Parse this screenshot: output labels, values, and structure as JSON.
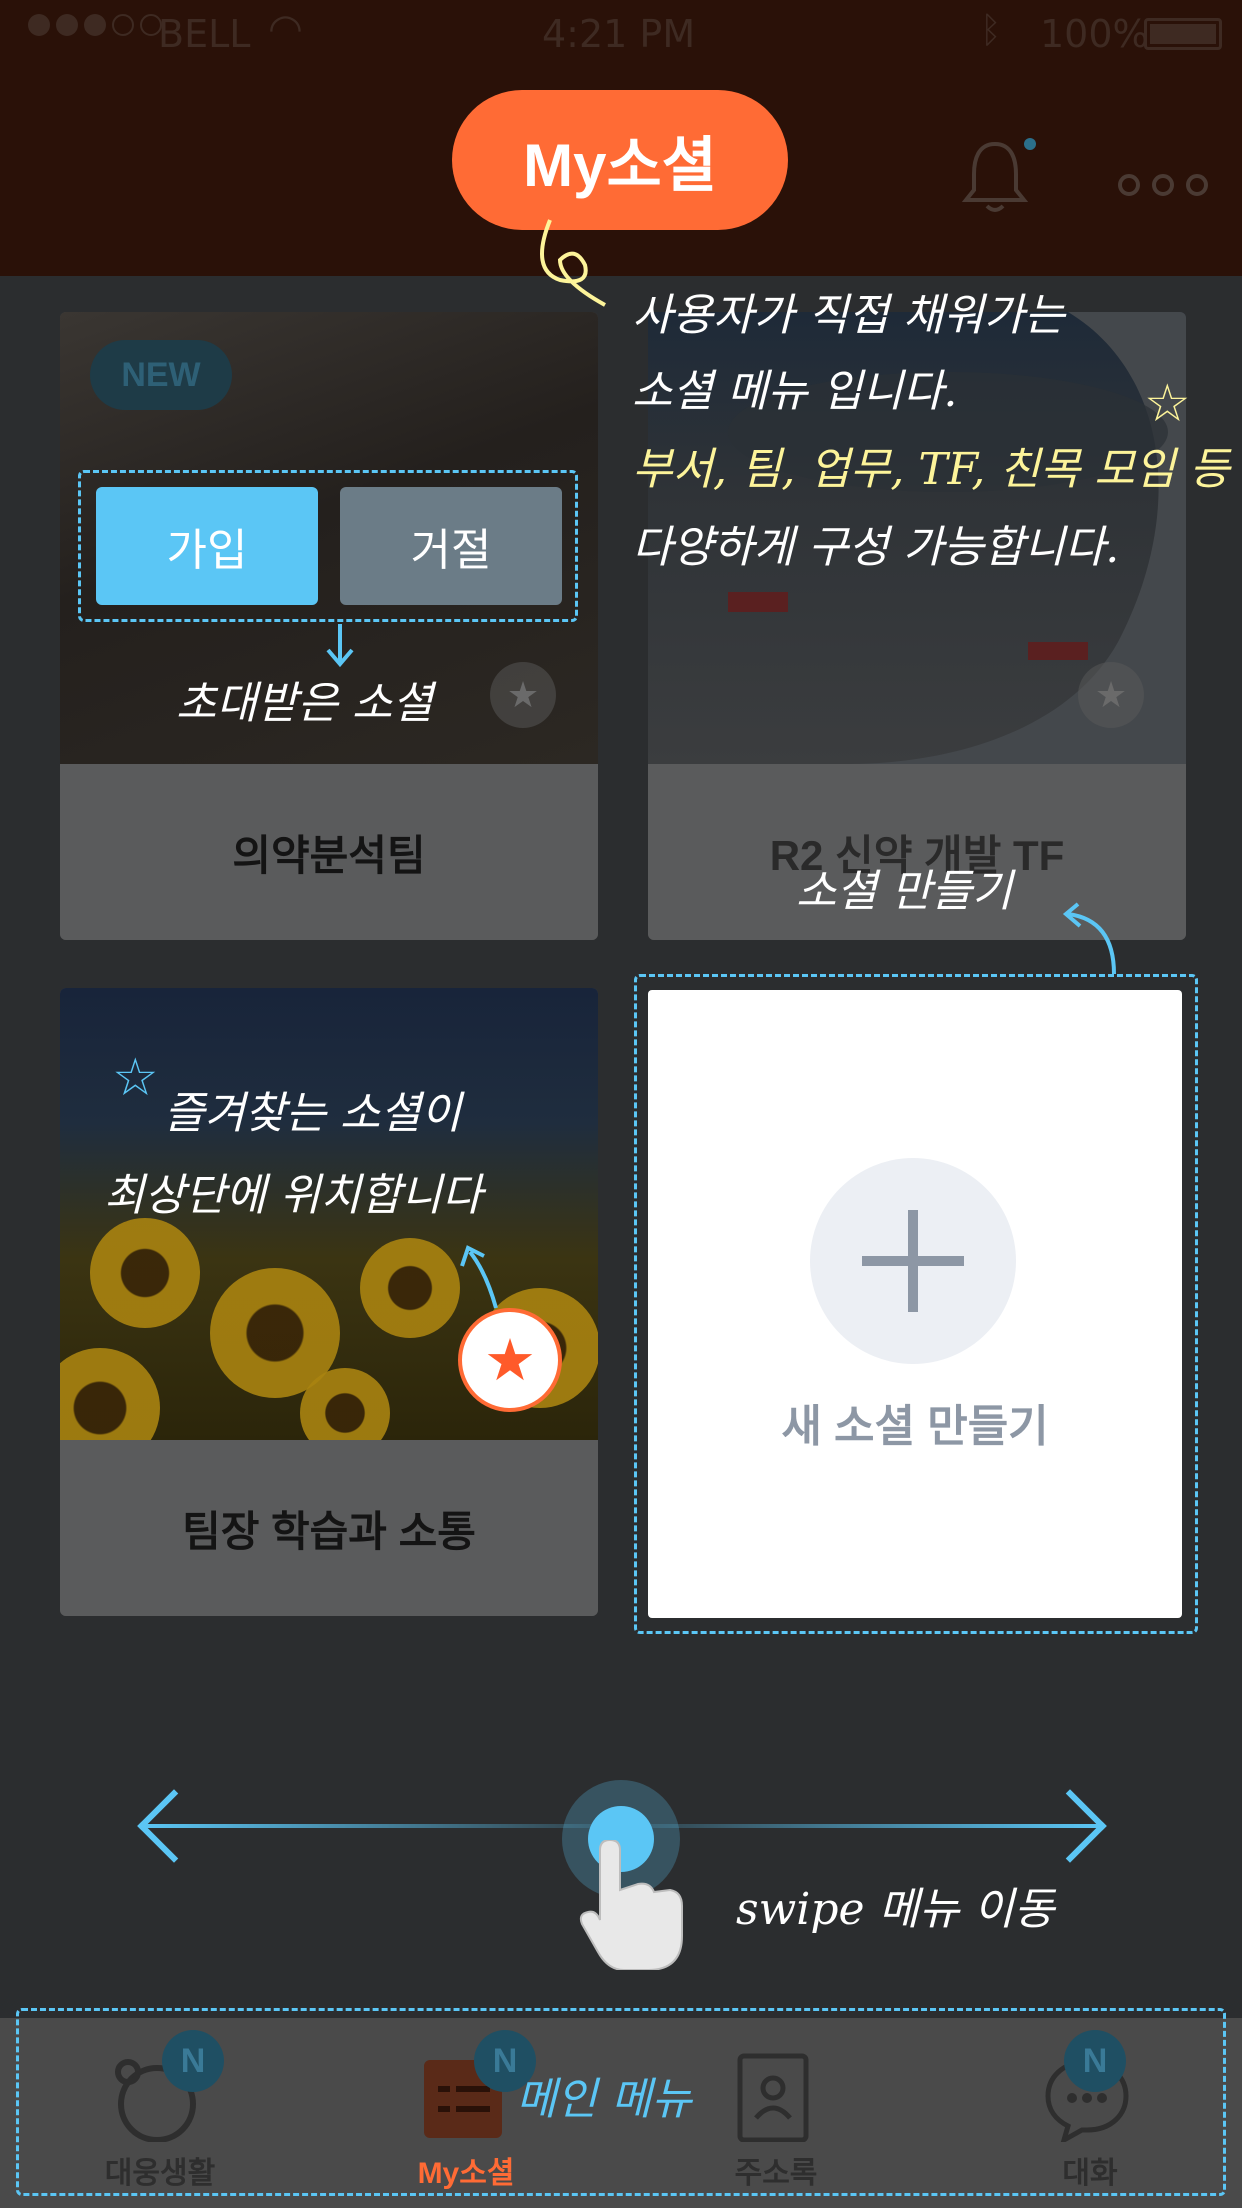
{
  "status_bar": {
    "carrier": "BELL",
    "time": "4:21 PM",
    "battery": "100%"
  },
  "header": {
    "title": "My소셜",
    "bell_icon": "bell-icon",
    "more_icon": "more-dots-icon"
  },
  "cards": [
    {
      "name": "의약분석팀",
      "badge": "NEW",
      "join_label": "가입",
      "reject_label": "거절"
    },
    {
      "name": "R2 신약 개발 TF"
    },
    {
      "name": "팀장 학습과 소통",
      "favorite": true
    }
  ],
  "new_social": {
    "label": "새 소셜 만들기",
    "icon": "plus-icon"
  },
  "tabbar": {
    "tabs": [
      {
        "label": "대웅생활",
        "badge": "N",
        "icon": "bear-icon"
      },
      {
        "label": "My소셜",
        "badge": "N",
        "icon": "list-icon",
        "active": true
      },
      {
        "label": "주소록",
        "icon": "contacts-book-icon"
      },
      {
        "label": "대화",
        "badge": "N",
        "icon": "chat-bubble-icon"
      }
    ]
  },
  "annotations": {
    "intro_line1": "사용자가 직접 채워가는",
    "intro_line2": "소셜 메뉴 입니다.",
    "intro_line3": "부서, 팀, 업무, TF, 친목 모임 등",
    "intro_line4": "다양하게 구성 가능합니다.",
    "invited": "초대받은 소셜",
    "create": "소셜 만들기",
    "favorite_line1": "즐겨찾는 소셜이",
    "favorite_line2": "최상단에 위치합니다",
    "swipe": "swipe 메뉴 이동",
    "main_menu": "메인 메뉴"
  },
  "colors": {
    "accent": "#ff6b35",
    "annotation_blue": "#5bc6f5",
    "annotation_yellow": "#fdf49a"
  }
}
